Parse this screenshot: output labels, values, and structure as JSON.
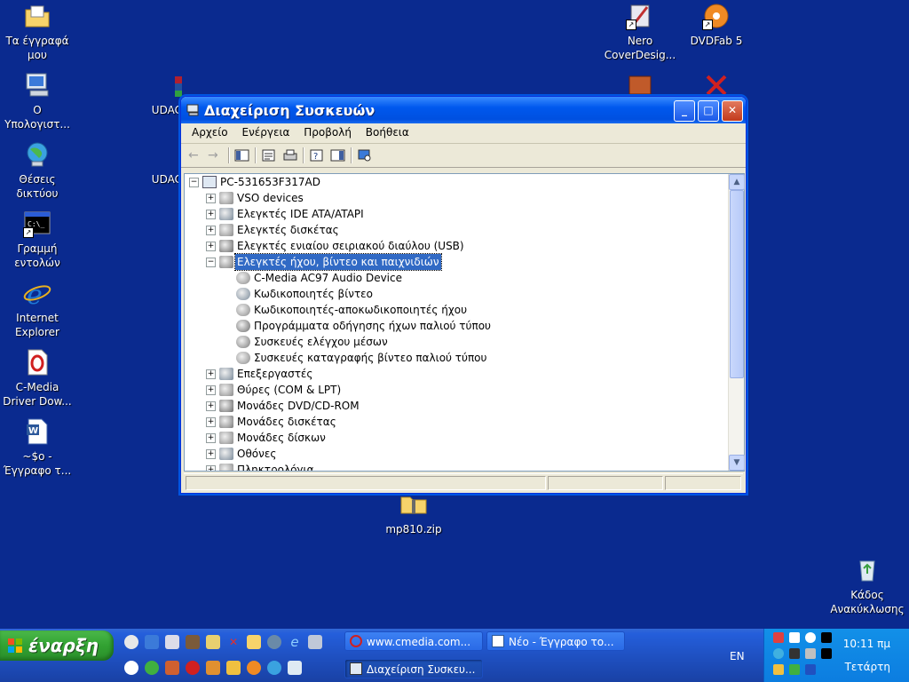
{
  "desktop": {
    "icons": [
      {
        "label": "Τα έγγραφά μου"
      },
      {
        "label": "Ο Υπολογιστ..."
      },
      {
        "label": "Θέσεις δικτύου"
      },
      {
        "label": "Γραμμή εντολών"
      },
      {
        "label": "Internet Explorer"
      },
      {
        "label": "C-Media Driver Dow..."
      },
      {
        "label": "~$ο - Έγγραφο τ..."
      },
      {
        "label": "Nero CoverDesig..."
      },
      {
        "label": "DVDFab 5"
      },
      {
        "label": "UDAC"
      },
      {
        "label": "UDAC"
      },
      {
        "label": "mp810.zip"
      },
      {
        "label": "Κάδος Ανακύκλωσης"
      }
    ]
  },
  "window": {
    "title": "Διαχείριση Συσκευών",
    "menu": [
      "Αρχείο",
      "Ενέργεια",
      "Προβολή",
      "Βοήθεια"
    ],
    "tree": {
      "root": "PC-531653F317AD",
      "items": [
        {
          "label": "VSO devices",
          "expander": "+"
        },
        {
          "label": "Ελεγκτές IDE ATA/ATAPI",
          "expander": "+"
        },
        {
          "label": "Ελεγκτές δισκέτας",
          "expander": "+"
        },
        {
          "label": "Ελεγκτές ενιαίου σειριακού διαύλου (USB)",
          "expander": "+"
        },
        {
          "label": "Ελεγκτές ήχου, βίντεο και παιχνιδιών",
          "expander": "−",
          "selected": true
        },
        {
          "label": "C-Media AC97 Audio Device",
          "child": true
        },
        {
          "label": "Κωδικοποιητές βίντεο",
          "child": true
        },
        {
          "label": "Κωδικοποιητές-αποκωδικοποιητές ήχου",
          "child": true
        },
        {
          "label": "Προγράμματα οδήγησης ήχων παλιού τύπου",
          "child": true
        },
        {
          "label": "Συσκευές ελέγχου μέσων",
          "child": true
        },
        {
          "label": "Συσκευές καταγραφής βίντεο παλιού τύπου",
          "child": true
        },
        {
          "label": "Επεξεργαστές",
          "expander": "+"
        },
        {
          "label": "Θύρες (COM & LPT)",
          "expander": "+"
        },
        {
          "label": "Μονάδες DVD/CD-ROM",
          "expander": "+"
        },
        {
          "label": "Μονάδες δισκέτας",
          "expander": "+"
        },
        {
          "label": "Μονάδες δίσκων",
          "expander": "+"
        },
        {
          "label": "Οθόνες",
          "expander": "+"
        },
        {
          "label": "Πληκτρολόγια",
          "expander": "+"
        }
      ]
    }
  },
  "taskbar": {
    "start_label": "έναρξη",
    "tasks": [
      {
        "label": "www.cmedia.com..."
      },
      {
        "label": "Νέο - Έγγραφο το..."
      },
      {
        "label": "Διαχείριση Συσκευ..."
      }
    ],
    "language": "EN",
    "time": "10:11 πμ",
    "day": "Τετάρτη"
  }
}
